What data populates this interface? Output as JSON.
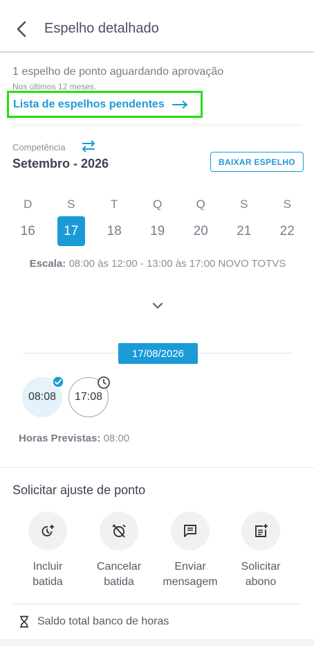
{
  "header": {
    "title": "Espelho detalhado",
    "back_icon": "chevron-left-icon"
  },
  "pending": {
    "message": "1 espelho de ponto aguardando aprovação",
    "subtext": "Nos últimos 12 meses.",
    "link_label": "Lista de espelhos pendentes",
    "link_icon": "arrow-right-icon"
  },
  "competencia": {
    "label": "Competência",
    "period": "Setembro - 2026",
    "download_label": "BAIXAR ESPELHO",
    "swap_icon": "swap-arrows-icon"
  },
  "calendar": {
    "weekdays": [
      "D",
      "S",
      "T",
      "Q",
      "Q",
      "S",
      "S"
    ],
    "days": [
      "16",
      "17",
      "18",
      "19",
      "20",
      "21",
      "22"
    ],
    "selected": "17"
  },
  "escala": {
    "label": "Escala:",
    "value": "08:00 às 12:00 - 13:00 às 17:00  NOVO TOTVS"
  },
  "day_detail": {
    "date": "17/08/2026",
    "punches": [
      {
        "time": "08:08",
        "status": "approved"
      },
      {
        "time": "17:08",
        "status": "pending"
      }
    ],
    "horas_label": "Horas Previstas:",
    "horas_value": "08:00"
  },
  "ajuste": {
    "title": "Solicitar ajuste de ponto",
    "actions": [
      {
        "line1": "Incluir",
        "line2": "batida",
        "icon": "clock-plus-icon"
      },
      {
        "line1": "Cancelar",
        "line2": "batida",
        "icon": "alarm-off-icon"
      },
      {
        "line1": "Enviar",
        "line2": "mensagem",
        "icon": "message-icon"
      },
      {
        "line1": "Solicitar",
        "line2": "abono",
        "icon": "note-add-icon"
      }
    ]
  },
  "saldo": {
    "label": "Saldo total banco de horas",
    "icon": "hourglass-icon"
  },
  "colors": {
    "accent": "#1a9bd7",
    "highlight_border": "#22e014"
  }
}
